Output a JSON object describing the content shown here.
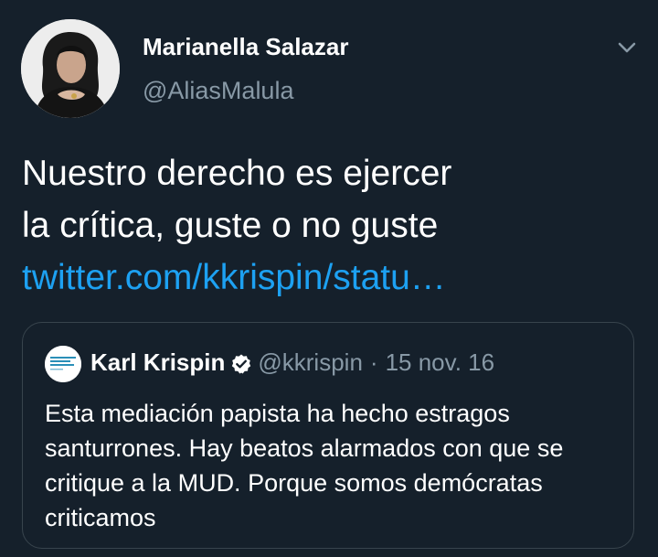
{
  "tweet": {
    "author": {
      "name": "Marianella Salazar",
      "handle": "@AliasMalula",
      "avatar_icon": "profile-photo-icon"
    },
    "menu_icon": "chevron-down-icon",
    "text_lines": [
      "Nuestro derecho es ejercer",
      "la crítica, guste o no guste"
    ],
    "link": "twitter.com/kkrispin/statu…"
  },
  "quoted_tweet": {
    "author": {
      "name": "Karl Krispin",
      "handle": "@kkrispin",
      "verified_icon": "verified-badge-icon",
      "avatar_icon": "profile-photo-icon"
    },
    "separator": "·",
    "date": "15 nov. 16",
    "text": "Esta mediación papista ha hecho estragos santurrones. Hay beatos alarmados con que se critique a la MUD. Porque somos demócratas criticamos"
  },
  "colors": {
    "background": "#15202b",
    "text": "#ffffff",
    "secondary_text": "#8899a6",
    "link": "#1da1f2",
    "border": "#38444d"
  }
}
